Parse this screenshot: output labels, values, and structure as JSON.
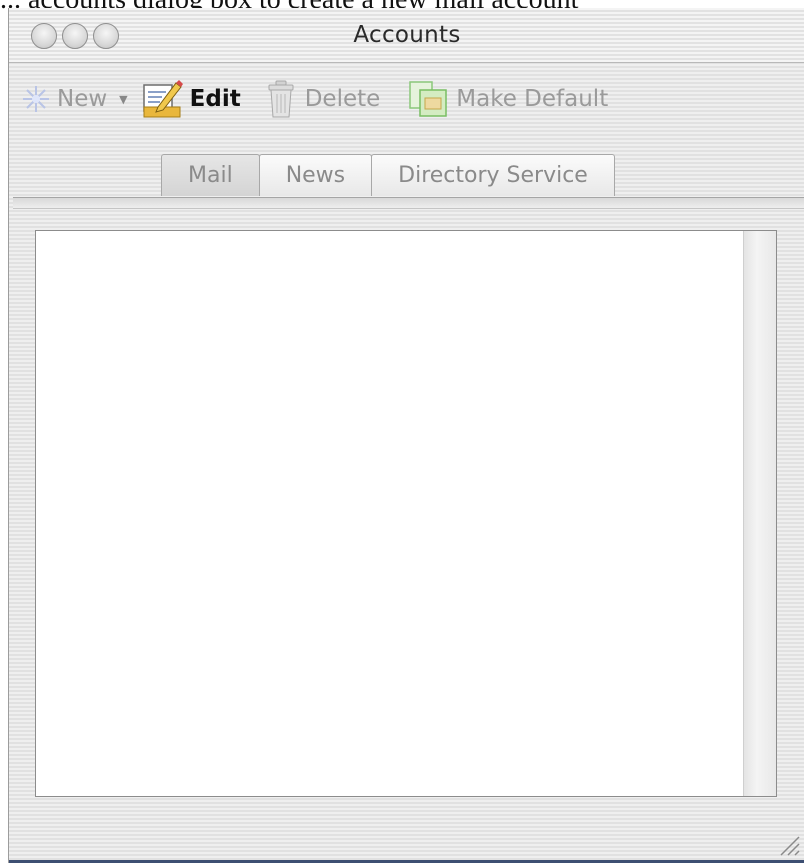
{
  "caption": "... accounts dialog box to create a new mail account",
  "window": {
    "title": "Accounts"
  },
  "toolbar": {
    "new_label": "New",
    "edit_label": "Edit",
    "delete_label": "Delete",
    "make_default_label": "Make Default"
  },
  "tabs": [
    {
      "label": "Mail",
      "selected": true
    },
    {
      "label": "News",
      "selected": false
    },
    {
      "label": "Directory Service",
      "selected": false
    }
  ],
  "icons": {
    "new": "sparkle-icon",
    "edit": "edit-pencil-icon",
    "delete": "trash-can-icon",
    "make_default": "make-default-icon",
    "resize": "resize-grip-icon"
  },
  "colors": {
    "title_text": "#2a2a2a",
    "disabled_text": "#9a9a9a",
    "enabled_text": "#111111",
    "bottom_edge": "#3d4f72"
  }
}
